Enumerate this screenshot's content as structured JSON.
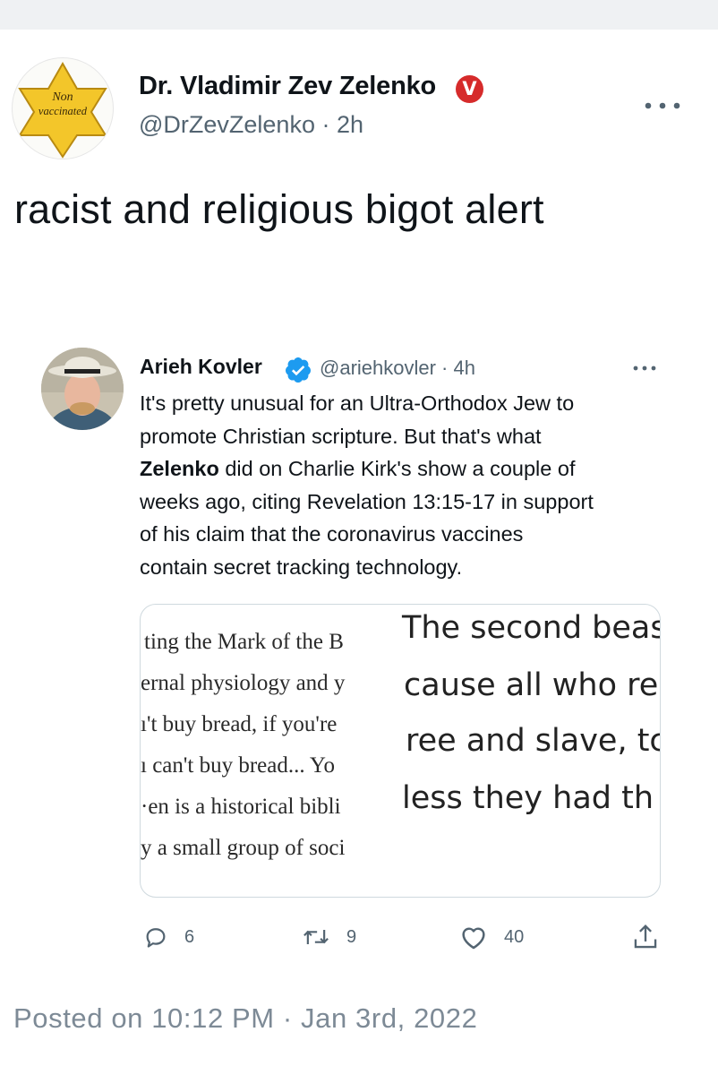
{
  "post": {
    "author_name": "Dr. Vladimir Zev Zelenko",
    "badge_letter": "V",
    "handle_time": "@DrZevZelenko · 2h",
    "avatar_star_text_line1": "Non",
    "avatar_star_text_line2": "vaccinated",
    "text": "racist and religious bigot alert"
  },
  "quoted": {
    "author_name": "Arieh Kovler",
    "handle_time": "@ariehkovler · 4h",
    "body_lines": [
      "It's pretty unusual for an Ultra-Orthodox Jew to",
      "promote Christian scripture. But that's what",
      "Zelenko",
      " did on Charlie Kirk's show a couple of",
      "weeks ago, citing Revelation 13:15-17 in support",
      "of his claim that the coronavirus vaccines",
      "contain secret tracking technology."
    ],
    "media_left_lines": [
      "ting the Mark of the B",
      "ernal physiology and y",
      "ı't buy bread, if you're",
      "ı can't buy bread... Yo",
      "·en is a historical bibli",
      "y a small group of soci"
    ],
    "media_right_lines": [
      "The second beas",
      "cause all who re",
      "ree and slave, tc",
      "less they had th"
    ],
    "actions": {
      "replies": "6",
      "retweets": "9",
      "likes": "40"
    }
  },
  "footer": {
    "posted": "Posted on 10:12 PM · Jan 3rd, 2022"
  },
  "colors": {
    "text_primary": "#0f1419",
    "text_secondary": "#536471",
    "badge_red": "#d62b2b",
    "verified_blue": "#1d9bf0",
    "star_yellow": "#f3c62a",
    "border": "#cfd9de"
  },
  "icons": [
    "more-icon",
    "verified-badge-icon",
    "reply-icon",
    "retweet-icon",
    "like-icon",
    "share-icon"
  ]
}
